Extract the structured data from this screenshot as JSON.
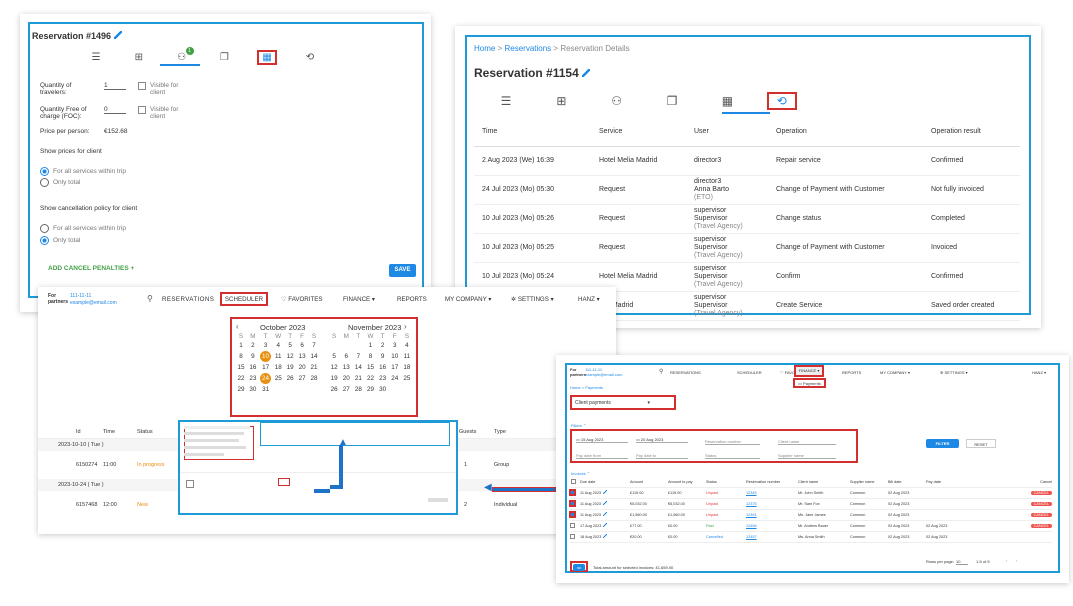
{
  "p1": {
    "title": "Reservation #1496",
    "qty_label": "Quantity of travelers:",
    "qty_value": "1",
    "foc_label": "Quantity Free of charge (FOC):",
    "foc_value": "0",
    "visible_label": "Visible for client",
    "visible_label2": "Visible for client",
    "price_label": "Price per person:",
    "price_value": "€152.68",
    "show_prices": "Show prices for client",
    "opt_all": "For all services within trip",
    "opt_total": "Only total",
    "show_cancel": "Show cancellation policy for client",
    "opt_all2": "For all services within trip",
    "opt_total2": "Only total",
    "add_penalties": "ADD CANCEL PENALTIES +",
    "save": "SAVE",
    "badge": "1"
  },
  "p2": {
    "breadcrumb": {
      "home": "Home",
      "reservations": "Reservations",
      "details": "Reservation Details",
      "sep": ">"
    },
    "title": "Reservation #1154",
    "headers": [
      "Time",
      "Service",
      "User",
      "Operation",
      "Operation result"
    ],
    "rows": [
      {
        "time": "2 Aug 2023 (We) 16:39",
        "service": "Hotel Melia Madrid",
        "u1": "",
        "u2": "director3",
        "u3": "",
        "op": "Repair service",
        "res": "Confirmed"
      },
      {
        "time": "24 Jul 2023 (Mo) 05:30",
        "service": "Request",
        "u1": "director3",
        "u2": "Anna Barto",
        "u3": "(ETO)",
        "op": "Change of Payment with Customer",
        "res": "Not fully invoiced"
      },
      {
        "time": "10 Jul 2023 (Mo) 05:26",
        "service": "Request",
        "u1": "supervisor",
        "u2": "Supervisor",
        "u3": "(Travel Agency)",
        "op": "Change status",
        "res": "Completed"
      },
      {
        "time": "10 Jul 2023 (Mo) 05:25",
        "service": "Request",
        "u1": "supervisor",
        "u2": "Supervisor",
        "u3": "(Travel Agency)",
        "op": "Change of Payment with Customer",
        "res": "Invoiced"
      },
      {
        "time": "10 Jul 2023 (Mo) 05:24",
        "service": "Hotel Melia Madrid",
        "u1": "supervisor",
        "u2": "Supervisor",
        "u3": "(Travel Agency)",
        "op": "Confirm",
        "res": "Confirmed"
      },
      {
        "time": "",
        "service": "elia Madrid",
        "u1": "supervisor",
        "u2": "Supervisor",
        "u3": "(Travel Agency)",
        "op": "Create Service",
        "res": "Saved order created"
      }
    ]
  },
  "p3": {
    "for_partners": "For partners",
    "phone": "111-11-11",
    "email": "example@email.com",
    "nav": {
      "reservations": "RESERVATIONS",
      "scheduler": "SCHEDULER",
      "favorites": "♡ FAVORITES",
      "finance": "FINANCE",
      "reports": "REPORTS",
      "company": "MY COMPANY",
      "settings": "SETTINGS",
      "user": "HANZ"
    },
    "cal1": {
      "title": "October 2023",
      "days": [
        "S",
        "M",
        "T",
        "W",
        "T",
        "F",
        "S"
      ],
      "weeks": [
        [
          "1",
          "2",
          "3",
          "4",
          "5",
          "6",
          "7"
        ],
        [
          "8",
          "9",
          "10",
          "11",
          "12",
          "13",
          "14"
        ],
        [
          "15",
          "16",
          "17",
          "18",
          "19",
          "20",
          "21"
        ],
        [
          "22",
          "23",
          "24",
          "25",
          "26",
          "27",
          "28"
        ],
        [
          "29",
          "30",
          "31",
          "",
          "",
          "",
          ""
        ]
      ]
    },
    "cal2": {
      "title": "November 2023",
      "days": [
        "S",
        "M",
        "T",
        "W",
        "T",
        "F",
        "S"
      ],
      "weeks": [
        [
          "",
          "",
          "",
          "1",
          "2",
          "3",
          "4"
        ],
        [
          "5",
          "6",
          "7",
          "8",
          "9",
          "10",
          "11"
        ],
        [
          "12",
          "13",
          "14",
          "15",
          "16",
          "17",
          "18"
        ],
        [
          "19",
          "20",
          "21",
          "22",
          "23",
          "24",
          "25"
        ],
        [
          "26",
          "27",
          "28",
          "29",
          "30",
          "",
          ""
        ]
      ]
    },
    "cols": {
      "id": "Id",
      "time": "Time",
      "status": "Status",
      "guests": "Guests",
      "type": "Type"
    },
    "group1": "2023-10-10 ( Tue )",
    "r1": {
      "id": "6150274",
      "time": "11:00",
      "status": "In progress",
      "guests": "1",
      "type": "Group"
    },
    "group2": "2023-10-24 ( Tue )",
    "r2": {
      "id": "6157468",
      "time": "12:00",
      "status": "New",
      "guests": "2",
      "type": "Individual"
    }
  },
  "p4": {
    "for_partners": "For partners",
    "phone": "111-11-11",
    "email": "example@email.com",
    "nav": {
      "reservations": "RESERVATIONS",
      "scheduler": "SCHEDULER",
      "favorites": "♡ FAVORITES",
      "finance": "FINANCE",
      "reports": "REPORTS",
      "company": "MY COMPANY",
      "settings": "SETTINGS",
      "user": "HANZ"
    },
    "payments_menu": "Payments",
    "breadcrumb": "Home > Payments",
    "select": "Client payments",
    "filters": "Filters ⌃",
    "date1": "15 Aug 2023",
    "date2": "20 Aug 2023",
    "pay_from": "Pay date from",
    "pay_to": "Pay date to",
    "resnum": "Reservation number",
    "client": "Client name",
    "status": "Status",
    "supplier": "Supplier name",
    "filter_btn": "FILTER",
    "reset_btn": "RESET",
    "invoices": "Invoices ⌃",
    "headers": [
      "Due date",
      "Amount",
      "Amount to pay",
      "Status",
      "Reservation number",
      "Client name",
      "Supplier name",
      "Bill date",
      "Pay date",
      "Cancel"
    ],
    "rows": [
      {
        "date": "11 Aug 2023",
        "amt": "£119.00",
        "pay": "£119.00",
        "st": "Unpaid",
        "num": "12345",
        "client": "Mr. John Smith",
        "sup": "Common",
        "bill": "02 Aug 2023",
        "pd": "",
        "c": "CANCEL"
      },
      {
        "date": "11 Aug 2023",
        "amt": "€5,032.00",
        "pay": "€5,032.00",
        "st": "Unpaid",
        "num": "12375",
        "client": "Mr. Sam Fox",
        "sup": "Common",
        "bill": "02 Aug 2023",
        "pd": "",
        "c": "CANCEL"
      },
      {
        "date": "11 Aug 2023",
        "amt": "£1,560.00",
        "pay": "£1,560.00",
        "st": "Unpaid",
        "num": "12391",
        "client": "Ms. Jane James",
        "sup": "Common",
        "bill": "02 Aug 2023",
        "pd": "",
        "c": "CANCEL"
      },
      {
        "date": "17 Aug 2023",
        "amt": "£77.00",
        "pay": "£0.00",
        "st": "Paid",
        "num": "12456",
        "client": "Mr. Andrew Bauer",
        "sup": "Common",
        "bill": "02 Aug 2023",
        "pd": "02 Aug 2023",
        "c": "CANCEL"
      },
      {
        "date": "18 Aug 2023",
        "amt": "€20.00",
        "pay": "£0.00",
        "st": "Cancelled",
        "num": "12457",
        "client": "Ms. Anna Smith",
        "sup": "Common",
        "bill": "02 Aug 2023",
        "pd": "02 Aug 2023",
        "c": ""
      }
    ],
    "rows_per_page": "Rows per page:",
    "rpp": "10",
    "range": "1-5 of 5",
    "pay_btn": "PAY",
    "total": "Total amount for selected invoices: £1,659.00"
  }
}
